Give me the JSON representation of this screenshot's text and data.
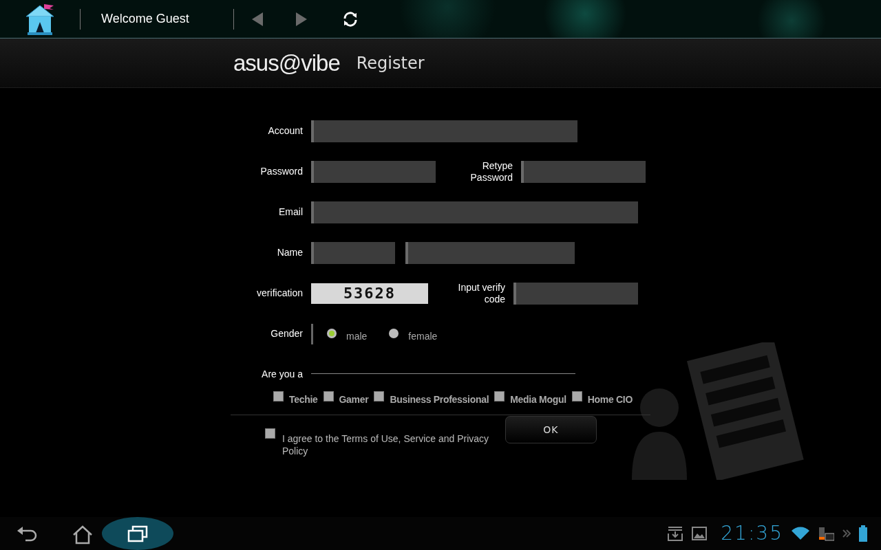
{
  "top_bar": {
    "greeting": "Welcome Guest"
  },
  "header": {
    "logo": "asus@vibe",
    "title": "Register"
  },
  "form": {
    "account": {
      "label": "Account"
    },
    "password": {
      "label": "Password"
    },
    "retype_password": {
      "label": "Retype Password"
    },
    "email": {
      "label": "Email"
    },
    "name": {
      "label": "Name"
    },
    "verification": {
      "label": "verification",
      "captcha": "53628"
    },
    "verify_code": {
      "label": "Input verify code"
    },
    "gender": {
      "label": "Gender",
      "options": [
        {
          "label": "male",
          "selected": true
        },
        {
          "label": "female",
          "selected": false
        }
      ]
    },
    "role": {
      "label": "Are you a",
      "options": [
        {
          "label": "Techie",
          "checked": false
        },
        {
          "label": "Gamer",
          "checked": false
        },
        {
          "label": "Business Professional",
          "checked": false
        },
        {
          "label": "Media Mogul",
          "checked": false
        },
        {
          "label": "Home CIO",
          "checked": false
        }
      ]
    },
    "agree": {
      "label": "I agree to the Terms of Use, Service and Privacy Policy",
      "checked": false
    },
    "ok_button": "OK"
  },
  "status_bar": {
    "time": "21:35"
  }
}
